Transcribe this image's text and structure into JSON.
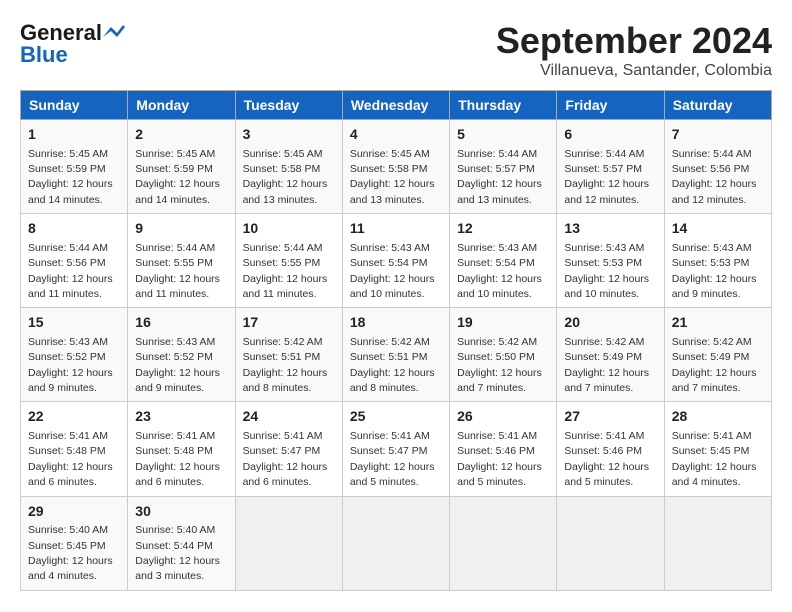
{
  "header": {
    "logo_general": "General",
    "logo_blue": "Blue",
    "month": "September 2024",
    "location": "Villanueva, Santander, Colombia"
  },
  "calendar": {
    "days_of_week": [
      "Sunday",
      "Monday",
      "Tuesday",
      "Wednesday",
      "Thursday",
      "Friday",
      "Saturday"
    ],
    "weeks": [
      [
        {
          "day": "",
          "info": ""
        },
        {
          "day": "2",
          "info": "Sunrise: 5:45 AM\nSunset: 5:59 PM\nDaylight: 12 hours\nand 14 minutes."
        },
        {
          "day": "3",
          "info": "Sunrise: 5:45 AM\nSunset: 5:58 PM\nDaylight: 12 hours\nand 13 minutes."
        },
        {
          "day": "4",
          "info": "Sunrise: 5:45 AM\nSunset: 5:58 PM\nDaylight: 12 hours\nand 13 minutes."
        },
        {
          "day": "5",
          "info": "Sunrise: 5:44 AM\nSunset: 5:57 PM\nDaylight: 12 hours\nand 13 minutes."
        },
        {
          "day": "6",
          "info": "Sunrise: 5:44 AM\nSunset: 5:57 PM\nDaylight: 12 hours\nand 12 minutes."
        },
        {
          "day": "7",
          "info": "Sunrise: 5:44 AM\nSunset: 5:56 PM\nDaylight: 12 hours\nand 12 minutes."
        }
      ],
      [
        {
          "day": "1",
          "info": "Sunrise: 5:45 AM\nSunset: 5:59 PM\nDaylight: 12 hours\nand 14 minutes."
        },
        {
          "day": "9",
          "info": "Sunrise: 5:44 AM\nSunset: 5:55 PM\nDaylight: 12 hours\nand 11 minutes."
        },
        {
          "day": "10",
          "info": "Sunrise: 5:44 AM\nSunset: 5:55 PM\nDaylight: 12 hours\nand 11 minutes."
        },
        {
          "day": "11",
          "info": "Sunrise: 5:43 AM\nSunset: 5:54 PM\nDaylight: 12 hours\nand 10 minutes."
        },
        {
          "day": "12",
          "info": "Sunrise: 5:43 AM\nSunset: 5:54 PM\nDaylight: 12 hours\nand 10 minutes."
        },
        {
          "day": "13",
          "info": "Sunrise: 5:43 AM\nSunset: 5:53 PM\nDaylight: 12 hours\nand 10 minutes."
        },
        {
          "day": "14",
          "info": "Sunrise: 5:43 AM\nSunset: 5:53 PM\nDaylight: 12 hours\nand 9 minutes."
        }
      ],
      [
        {
          "day": "8",
          "info": "Sunrise: 5:44 AM\nSunset: 5:56 PM\nDaylight: 12 hours\nand 11 minutes."
        },
        {
          "day": "16",
          "info": "Sunrise: 5:43 AM\nSunset: 5:52 PM\nDaylight: 12 hours\nand 9 minutes."
        },
        {
          "day": "17",
          "info": "Sunrise: 5:42 AM\nSunset: 5:51 PM\nDaylight: 12 hours\nand 8 minutes."
        },
        {
          "day": "18",
          "info": "Sunrise: 5:42 AM\nSunset: 5:51 PM\nDaylight: 12 hours\nand 8 minutes."
        },
        {
          "day": "19",
          "info": "Sunrise: 5:42 AM\nSunset: 5:50 PM\nDaylight: 12 hours\nand 7 minutes."
        },
        {
          "day": "20",
          "info": "Sunrise: 5:42 AM\nSunset: 5:49 PM\nDaylight: 12 hours\nand 7 minutes."
        },
        {
          "day": "21",
          "info": "Sunrise: 5:42 AM\nSunset: 5:49 PM\nDaylight: 12 hours\nand 7 minutes."
        }
      ],
      [
        {
          "day": "15",
          "info": "Sunrise: 5:43 AM\nSunset: 5:52 PM\nDaylight: 12 hours\nand 9 minutes."
        },
        {
          "day": "23",
          "info": "Sunrise: 5:41 AM\nSunset: 5:48 PM\nDaylight: 12 hours\nand 6 minutes."
        },
        {
          "day": "24",
          "info": "Sunrise: 5:41 AM\nSunset: 5:47 PM\nDaylight: 12 hours\nand 6 minutes."
        },
        {
          "day": "25",
          "info": "Sunrise: 5:41 AM\nSunset: 5:47 PM\nDaylight: 12 hours\nand 5 minutes."
        },
        {
          "day": "26",
          "info": "Sunrise: 5:41 AM\nSunset: 5:46 PM\nDaylight: 12 hours\nand 5 minutes."
        },
        {
          "day": "27",
          "info": "Sunrise: 5:41 AM\nSunset: 5:46 PM\nDaylight: 12 hours\nand 5 minutes."
        },
        {
          "day": "28",
          "info": "Sunrise: 5:41 AM\nSunset: 5:45 PM\nDaylight: 12 hours\nand 4 minutes."
        }
      ],
      [
        {
          "day": "22",
          "info": "Sunrise: 5:41 AM\nSunset: 5:48 PM\nDaylight: 12 hours\nand 6 minutes."
        },
        {
          "day": "30",
          "info": "Sunrise: 5:40 AM\nSunset: 5:44 PM\nDaylight: 12 hours\nand 3 minutes."
        },
        {
          "day": "",
          "info": ""
        },
        {
          "day": "",
          "info": ""
        },
        {
          "day": "",
          "info": ""
        },
        {
          "day": "",
          "info": ""
        },
        {
          "day": "",
          "info": ""
        }
      ],
      [
        {
          "day": "29",
          "info": "Sunrise: 5:40 AM\nSunset: 5:45 PM\nDaylight: 12 hours\nand 4 minutes."
        },
        {
          "day": "",
          "info": ""
        },
        {
          "day": "",
          "info": ""
        },
        {
          "day": "",
          "info": ""
        },
        {
          "day": "",
          "info": ""
        },
        {
          "day": "",
          "info": ""
        },
        {
          "day": "",
          "info": ""
        }
      ]
    ]
  }
}
